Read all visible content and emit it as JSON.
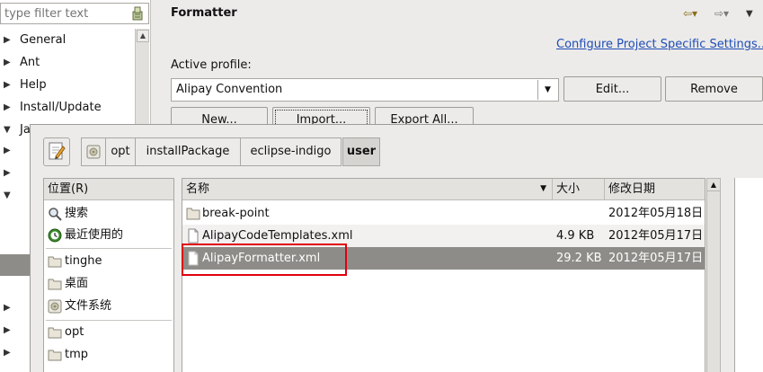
{
  "prefs_tree": {
    "filter_placeholder": "type filter text",
    "items": [
      {
        "label": "General"
      },
      {
        "label": "Ant"
      },
      {
        "label": "Help"
      },
      {
        "label": "Install/Update"
      },
      {
        "label": "Ja"
      }
    ]
  },
  "formatter": {
    "title": "Formatter",
    "configure_link": "Configure Project Specific Settings...",
    "active_profile_label": "Active profile:",
    "profile_value": "Alipay Convention",
    "edit_label": "Edit...",
    "remove_label": "Remove",
    "new_label": "New...",
    "import_label": "Import...",
    "export_all_label": "Export All..."
  },
  "file_chooser": {
    "path": [
      "opt",
      "installPackage",
      "eclipse-indigo",
      "user"
    ],
    "places_header": "位置(R)",
    "places": [
      {
        "label": "搜索",
        "icon": "search-icon"
      },
      {
        "label": "最近使用的",
        "icon": "recent-icon"
      }
    ],
    "bookmarks": [
      {
        "label": "tinghe",
        "icon": "folder-icon"
      },
      {
        "label": "桌面",
        "icon": "folder-icon"
      },
      {
        "label": "文件系统",
        "icon": "drive-icon"
      }
    ],
    "user_bookmarks": [
      {
        "label": "opt",
        "icon": "folder-icon"
      },
      {
        "label": "tmp",
        "icon": "folder-icon"
      }
    ],
    "columns": {
      "name": "名称",
      "size": "大小",
      "modified": "修改日期"
    },
    "files": [
      {
        "name": "break-point",
        "size": "",
        "modified": "2012年05月18日",
        "type": "folder"
      },
      {
        "name": "AlipayCodeTemplates.xml",
        "size": "4.9 KB",
        "modified": "2012年05月17日",
        "type": "file"
      },
      {
        "name": "AlipayFormatter.xml",
        "size": "29.2 KB",
        "modified": "2012年05月17日",
        "type": "file",
        "selected": true
      }
    ],
    "highlight_color": "#e0000f"
  }
}
